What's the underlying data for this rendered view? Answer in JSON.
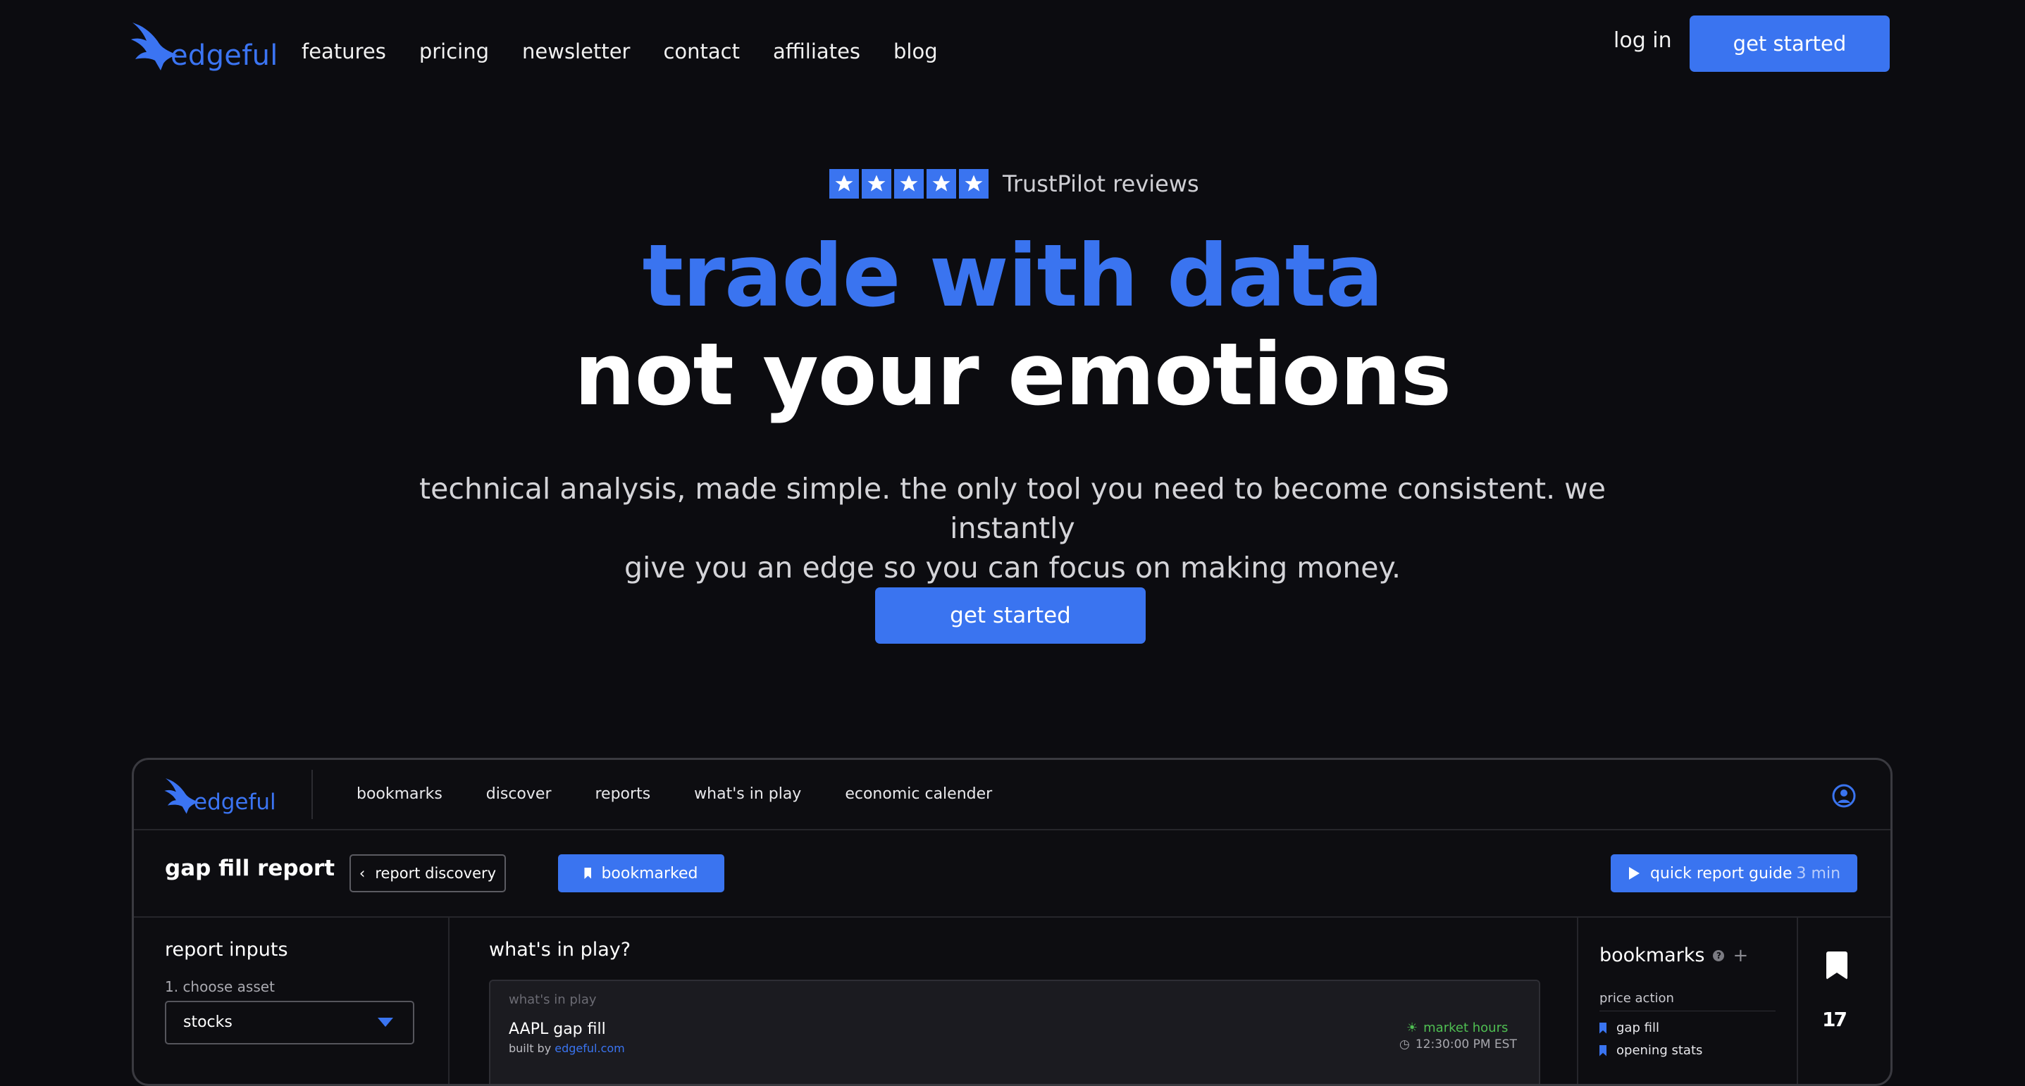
{
  "brand": {
    "name": "edgeful",
    "accent": "#3a74f0"
  },
  "nav": {
    "links": [
      "features",
      "pricing",
      "newsletter",
      "contact",
      "affiliates",
      "blog"
    ],
    "login": "log in",
    "cta": "get started"
  },
  "hero": {
    "trust_text": "TrustPilot reviews",
    "rating_stars": 5,
    "headline_1": "trade with data",
    "headline_2": "not your emotions",
    "subtitle_1": "technical analysis, made simple. the only tool you need to become consistent. we instantly",
    "subtitle_2": "give you an edge so you can focus on making money.",
    "cta": "get started"
  },
  "app": {
    "nav_links": [
      "bookmarks",
      "discover",
      "reports",
      "what's in play",
      "economic calender"
    ],
    "report_title": "gap fill report",
    "btn_discovery": "report discovery",
    "btn_bookmarked": "bookmarked",
    "btn_guide": "quick report guide",
    "btn_guide_time": "3 min",
    "inputs_title": "report inputs",
    "step_1": "1. choose asset",
    "asset_value": "stocks",
    "play_title": "what's in play?",
    "card": {
      "label": "what's in play",
      "title": "AAPL gap fill",
      "built_by_prefix": "built by",
      "built_by_link": "edgeful.com",
      "status": "market hours",
      "time": "12:30:00 PM EST"
    },
    "bookmarks_title": "bookmarks",
    "bookmarks_section": "price action",
    "bookmark_items": [
      "gap fill",
      "opening stats"
    ]
  }
}
